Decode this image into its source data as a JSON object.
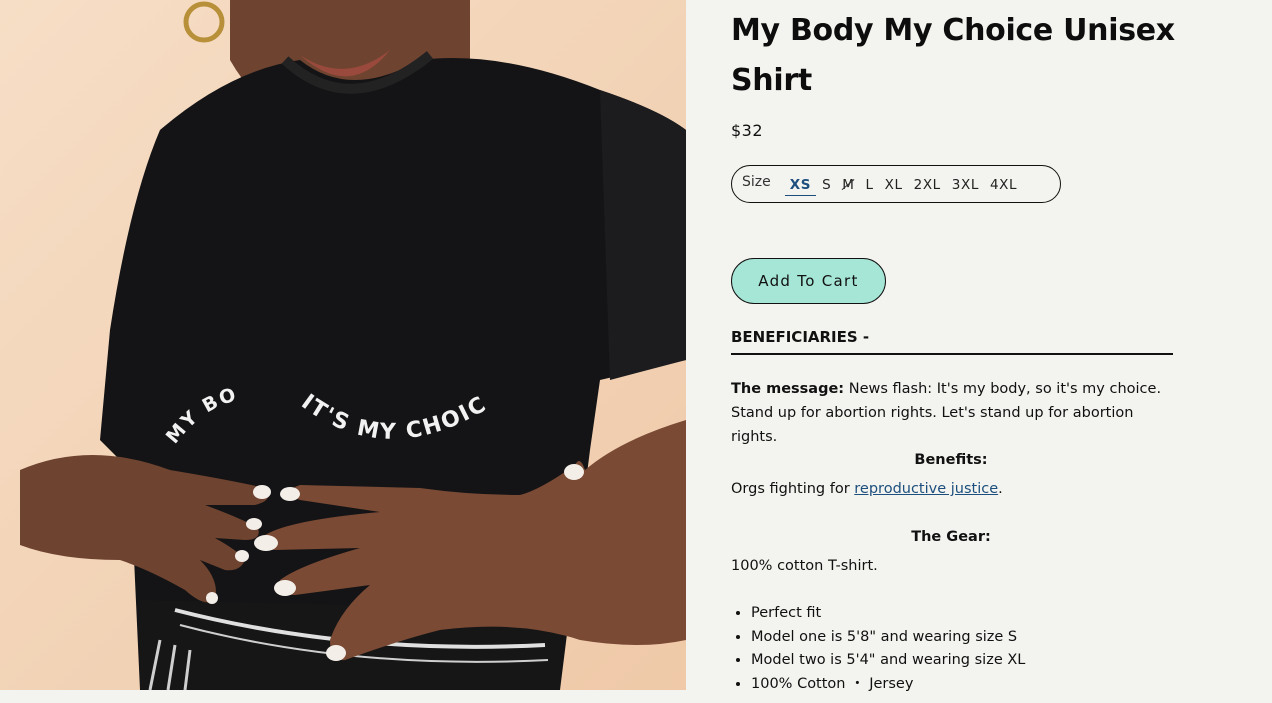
{
  "product": {
    "title": "My Body My Choice Unisex Shirt",
    "price": "$32",
    "image_alt": "Model wearing black t-shirt printed with MY BODY IT'S MY CHOICE"
  },
  "shirt_print": {
    "left_text": "MY BODY",
    "right_text": "IT'S MY CHOICE"
  },
  "size_selector": {
    "label": "Size",
    "options": [
      {
        "label": "XS",
        "selected": true,
        "available": true
      },
      {
        "label": "S",
        "selected": false,
        "available": true
      },
      {
        "label": "M",
        "selected": false,
        "available": false
      },
      {
        "label": "L",
        "selected": false,
        "available": true
      },
      {
        "label": "XL",
        "selected": false,
        "available": true
      },
      {
        "label": "2XL",
        "selected": false,
        "available": true
      },
      {
        "label": "3XL",
        "selected": false,
        "available": true
      },
      {
        "label": "4XL",
        "selected": false,
        "available": true
      }
    ]
  },
  "cart": {
    "button_label": "Add To Cart"
  },
  "details": {
    "beneficiaries_heading": "BENEFICIARIES -",
    "message_label": "The message:",
    "message_text": "News flash: It's my body, so it's my choice. Stand up for abortion rights. Let's stand up for abortion rights.",
    "benefits_heading": "Benefits:",
    "benefits_prefix": "Orgs fighting for ",
    "benefits_link": "reproductive justice",
    "benefits_suffix": ".",
    "gear_heading": "The Gear:",
    "gear_text": "100% cotton T-shirt.",
    "bullets": [
      "Perfect fit",
      "Model one is 5'8\" and wearing size S",
      "Model two is 5'4\" and wearing size XL",
      "100% Cotton ・ Jersey"
    ]
  },
  "colors": {
    "background": "#f3f4ef",
    "accent_button": "#a6e6d6",
    "link": "#1d4f7e",
    "shirt": "#141416",
    "skin": "#7a4a34",
    "backdrop": "#f3d8bf"
  }
}
